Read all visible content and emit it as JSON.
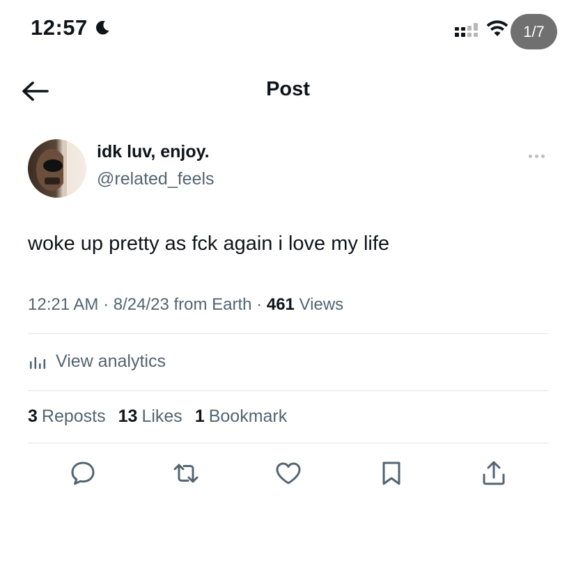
{
  "status_bar": {
    "time": "12:57",
    "moon_icon": "moon-icon",
    "signal_icon": "cellular-signal-icon",
    "wifi_icon": "wifi-icon",
    "page_indicator": "1/7"
  },
  "header": {
    "back_icon": "arrow-left-icon",
    "title": "Post"
  },
  "author": {
    "display_name": "idk luv, enjoy.",
    "handle": "@related_feels",
    "more_icon": "more-horizontal-icon"
  },
  "tweet": {
    "text": "woke up pretty as fck again i love my life"
  },
  "meta": {
    "time": "12:21 AM",
    "sep1": " · ",
    "date": "8/24/23",
    "source": " from Earth",
    "sep2": " · ",
    "views_count": "461",
    "views_label": " Views"
  },
  "analytics": {
    "icon": "analytics-bar-chart-icon",
    "label": "View analytics"
  },
  "stats": {
    "reposts_count": "3",
    "reposts_label": "Reposts",
    "likes_count": "13",
    "likes_label": "Likes",
    "bookmarks_count": "1",
    "bookmarks_label": "Bookmark"
  },
  "actions": [
    "reply-icon",
    "repost-icon",
    "like-icon",
    "bookmark-icon",
    "share-icon"
  ],
  "colors": {
    "text_primary": "#0f1419",
    "text_secondary": "#536471",
    "divider": "#dfe3e6",
    "pill_bg": "#707070"
  }
}
